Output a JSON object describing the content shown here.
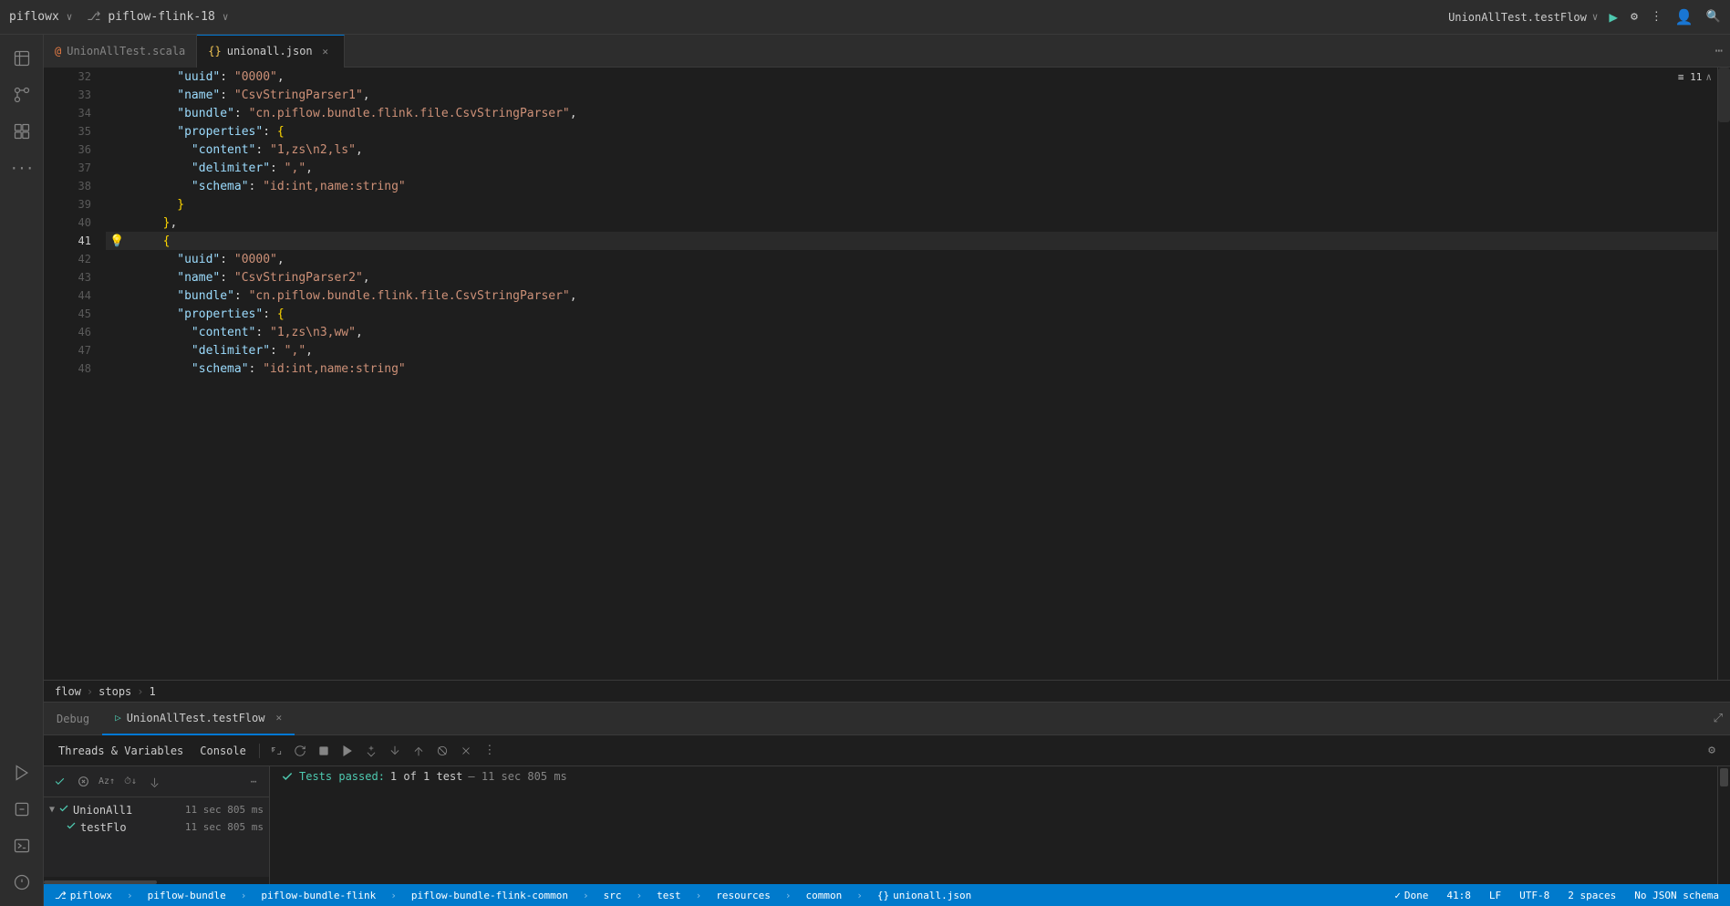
{
  "titlebar": {
    "project": "piflowx",
    "chevron": "∨",
    "branch_icon": "⎇",
    "branch": "piflow-flink-18",
    "run_config": "UnionAllTest.testFlow",
    "run_icon": "▶",
    "debug_icon": "🐞",
    "more_icon": "⋮",
    "profile_icon": "👤",
    "search_icon": "🔍"
  },
  "activity_bar": {
    "items": [
      {
        "name": "explorer-icon",
        "icon": "📁",
        "active": false
      },
      {
        "name": "source-control-icon",
        "icon": "◎",
        "active": false
      },
      {
        "name": "extensions-icon",
        "icon": "⊞",
        "active": false
      },
      {
        "name": "more-icon",
        "icon": "⋯",
        "active": false
      },
      {
        "name": "run-icon",
        "icon": "▷",
        "active": false
      },
      {
        "name": "debug-icon",
        "icon": "⬛",
        "active": false
      },
      {
        "name": "terminal-icon",
        "icon": "⊤",
        "active": false
      },
      {
        "name": "info-icon",
        "icon": "ℹ",
        "active": false
      }
    ]
  },
  "tabs": [
    {
      "name": "UnionAllTest.scala",
      "icon": "@",
      "active": false,
      "closable": false
    },
    {
      "name": "unionall.json",
      "icon": "{}",
      "active": true,
      "closable": true
    }
  ],
  "editor": {
    "lines": [
      {
        "num": 32,
        "content": "          \"uuid\": \"0000\",",
        "highlighted": false
      },
      {
        "num": 33,
        "content": "          \"name\": \"CsvStringParser1\",",
        "highlighted": false
      },
      {
        "num": 34,
        "content": "          \"bundle\": \"cn.piflow.bundle.flink.file.CsvStringParser\",",
        "highlighted": false
      },
      {
        "num": 35,
        "content": "          \"properties\": {",
        "highlighted": false
      },
      {
        "num": 36,
        "content": "            \"content\": \"1,zs\\n2,ls\",",
        "highlighted": false
      },
      {
        "num": 37,
        "content": "            \"delimiter\": \",\",",
        "highlighted": false
      },
      {
        "num": 38,
        "content": "            \"schema\": \"id:int,name:string\"",
        "highlighted": false
      },
      {
        "num": 39,
        "content": "          }",
        "highlighted": false
      },
      {
        "num": 40,
        "content": "        },",
        "highlighted": false
      },
      {
        "num": 41,
        "content": "        {",
        "highlighted": true,
        "hint": true
      },
      {
        "num": 42,
        "content": "          \"uuid\": \"0000\",",
        "highlighted": false
      },
      {
        "num": 43,
        "content": "          \"name\": \"CsvStringParser2\",",
        "highlighted": false
      },
      {
        "num": 44,
        "content": "          \"bundle\": \"cn.piflow.bundle.flink.file.CsvStringParser\",",
        "highlighted": false
      },
      {
        "num": 45,
        "content": "          \"properties\": {",
        "highlighted": false
      },
      {
        "num": 46,
        "content": "            \"content\": \"1,zs\\n3,ww\",",
        "highlighted": false
      },
      {
        "num": 47,
        "content": "            \"delimiter\": \",\",",
        "highlighted": false
      },
      {
        "num": 48,
        "content": "            \"schema\": \"id:int,name:string\"",
        "highlighted": false
      }
    ],
    "line_indicator": "≡ 11 ∧"
  },
  "breadcrumb": {
    "items": [
      "flow",
      "stops",
      "1"
    ]
  },
  "debug_panel": {
    "tabs": [
      {
        "name": "Debug",
        "icon": "",
        "active": false
      },
      {
        "name": "UnionAllTest.testFlow",
        "icon": "▷",
        "active": true,
        "closable": true
      }
    ],
    "toolbar": {
      "threads_vars_label": "Threads & Variables",
      "console_label": "Console",
      "buttons": [
        {
          "name": "restore-btn",
          "icon": "↺",
          "title": "Restore Layout"
        },
        {
          "name": "rerun-btn",
          "icon": "↻",
          "title": "Rerun"
        },
        {
          "name": "stop-btn",
          "icon": "■",
          "title": "Stop"
        },
        {
          "name": "resume-btn",
          "icon": "▶",
          "title": "Resume"
        },
        {
          "name": "step-over-btn",
          "icon": "⤵",
          "title": "Step Over"
        },
        {
          "name": "step-into-btn",
          "icon": "↓",
          "title": "Step Into"
        },
        {
          "name": "step-out-btn",
          "icon": "↑",
          "title": "Step Out"
        },
        {
          "name": "mute-btn",
          "icon": "◉",
          "title": "Mute Breakpoints"
        },
        {
          "name": "clear-btn",
          "icon": "✕",
          "title": "Clear"
        },
        {
          "name": "more-btn",
          "icon": "⋮",
          "title": "More"
        }
      ]
    },
    "filter_toolbar": {
      "buttons": [
        {
          "name": "check-btn",
          "icon": "☑",
          "active": true
        },
        {
          "name": "filter-fail-btn",
          "icon": "⊗"
        },
        {
          "name": "sort-alpha-btn",
          "icon": "Az↑"
        },
        {
          "name": "sort-dur-btn",
          "icon": "⏱↓"
        },
        {
          "name": "auto-scroll-btn",
          "icon": "↓⬜"
        },
        {
          "name": "more-filter-btn",
          "icon": "⋯"
        }
      ]
    },
    "test_results": {
      "pass_message": "Tests passed:",
      "pass_count": "1 of 1 test",
      "pass_time": "– 11 sec 805 ms",
      "suite": {
        "name": "UnionAll1",
        "time": "11 sec 805 ms",
        "status": "pass",
        "tests": [
          {
            "name": "testFlo",
            "time": "11 sec 805 ms",
            "status": "pass"
          }
        ]
      }
    }
  },
  "status_bar": {
    "left": [
      {
        "name": "branch-status",
        "icon": "⎇",
        "text": "piflowx"
      },
      {
        "name": "path-1",
        "text": "piflow-bundle"
      },
      {
        "name": "path-2",
        "text": "piflow-bundle-flink"
      },
      {
        "name": "path-3",
        "text": "piflow-bundle-flink-common"
      },
      {
        "name": "path-4",
        "text": "src"
      },
      {
        "name": "path-5",
        "text": "test"
      },
      {
        "name": "path-6",
        "text": "resources"
      },
      {
        "name": "path-7",
        "text": "common"
      },
      {
        "name": "path-8",
        "icon": "{}",
        "text": "unionall.json"
      }
    ],
    "right": [
      {
        "name": "done-status",
        "icon": "✓",
        "text": "Done"
      },
      {
        "name": "position",
        "text": "41:8"
      },
      {
        "name": "line-ending",
        "text": "LF"
      },
      {
        "name": "encoding",
        "text": "UTF-8"
      },
      {
        "name": "indent",
        "text": "2 spaces"
      },
      {
        "name": "schema",
        "text": "No JSON schema"
      }
    ]
  }
}
